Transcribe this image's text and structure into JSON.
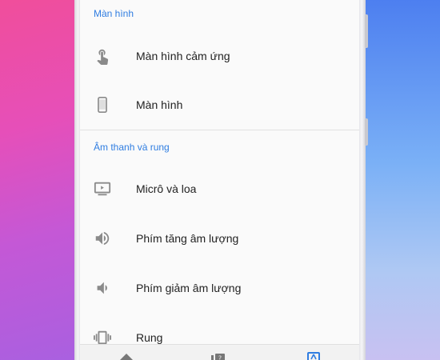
{
  "sections": [
    {
      "header": "Màn hình",
      "items": [
        {
          "label": "Màn hình cảm ứng",
          "icon": "touch-icon"
        },
        {
          "label": "Màn hình",
          "icon": "phone-icon"
        }
      ]
    },
    {
      "header": "Âm thanh và rung",
      "items": [
        {
          "label": "Micrô và loa",
          "icon": "speaker-screen-icon"
        },
        {
          "label": "Phím tăng âm lượng",
          "icon": "volume-up-icon"
        },
        {
          "label": "Phím giảm âm lượng",
          "icon": "volume-down-icon"
        },
        {
          "label": "Rung",
          "icon": "vibrate-icon"
        }
      ]
    }
  ],
  "bottom_nav": {
    "items": [
      {
        "icon": "home-icon"
      },
      {
        "icon": "help-icon"
      },
      {
        "icon": "tests-icon",
        "active": true
      }
    ]
  },
  "colors": {
    "accent": "#2f7de1",
    "icon": "#8a8a8a",
    "text": "#222222"
  }
}
